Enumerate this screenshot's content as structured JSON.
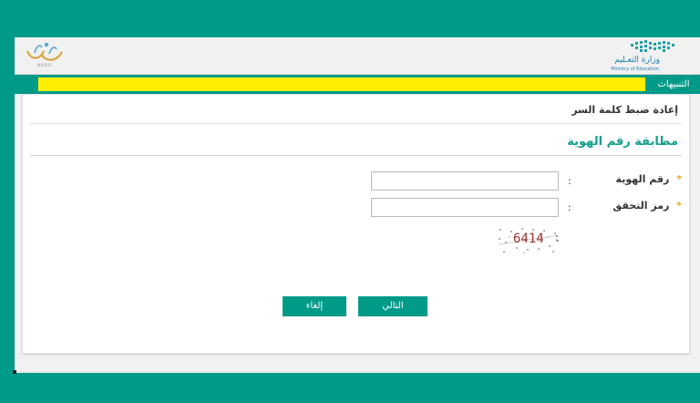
{
  "header": {
    "noor_logo_text": "NOOR",
    "ministry_name_ar": "وزارة التعـليم",
    "ministry_name_en": "Ministry of Education"
  },
  "alerts": {
    "label": "التنبيهات"
  },
  "page": {
    "title": "إعادة ضبط كلمة السر",
    "section_title": "مطابقة رقم الهوية"
  },
  "form": {
    "id_label": "رقم الهوية",
    "id_value": "",
    "captcha_label": "رمز التحقق",
    "captcha_value": "",
    "captcha_code": "6414",
    "required_marker": "*",
    "colon": ":"
  },
  "buttons": {
    "next": "التالي",
    "cancel": "إلغاء"
  },
  "colors": {
    "background": "#009a89",
    "accent": "#009a89",
    "alert_strip": "#ffee00",
    "section_title": "#12a08f",
    "required": "#f0a020"
  }
}
